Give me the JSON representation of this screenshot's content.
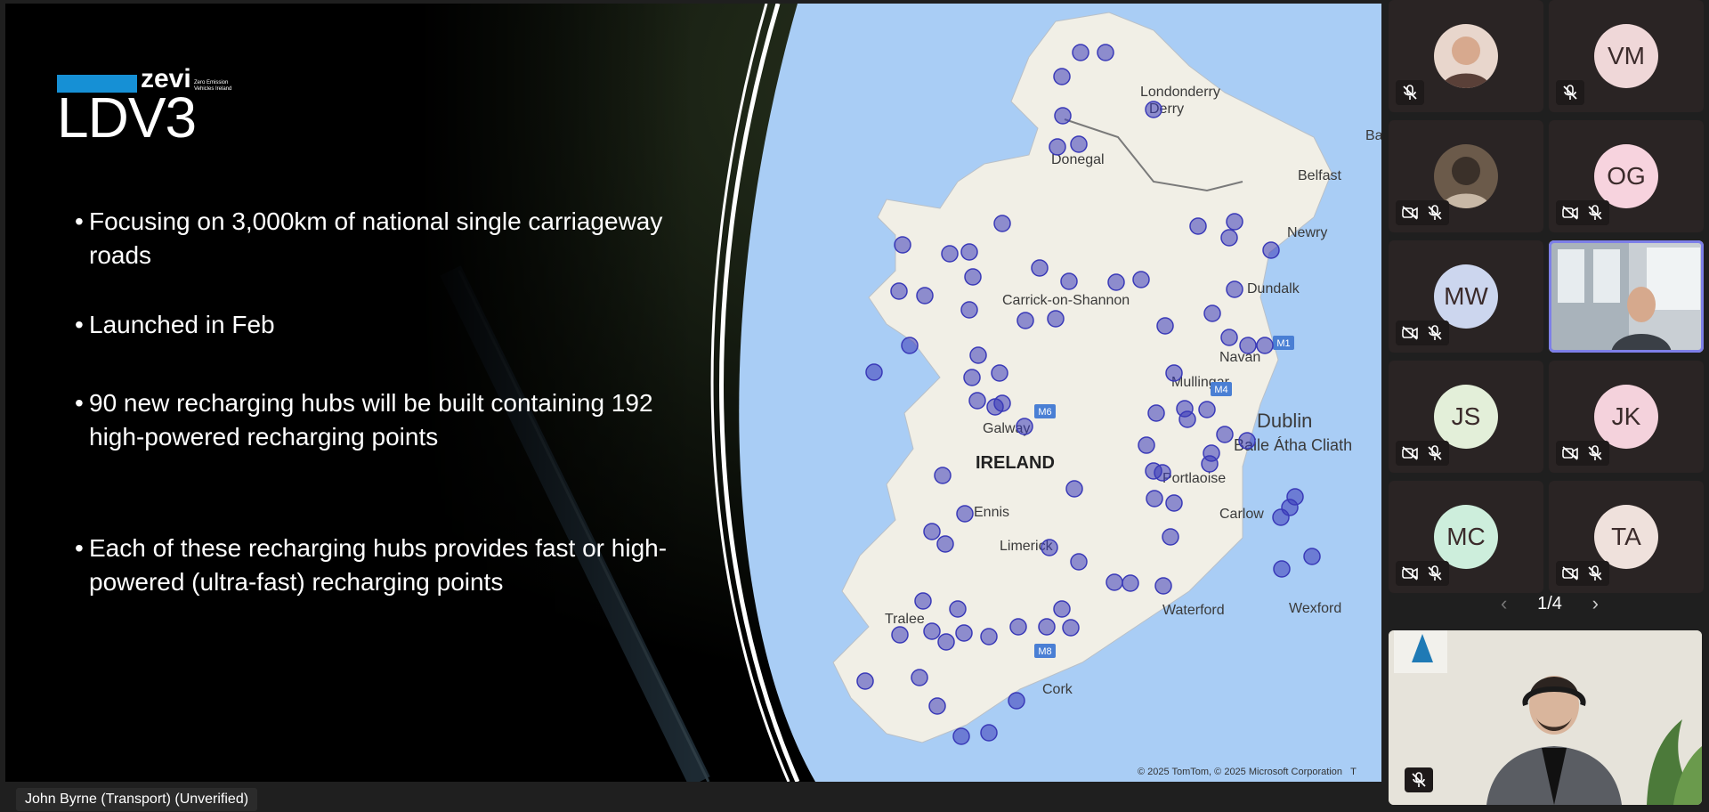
{
  "slide": {
    "logo": {
      "brand": "zevi",
      "brand_sub": "Zero Emission Vehicles Ireland",
      "title": "LDV3"
    },
    "bullets": [
      "Focusing on 3,000km of national single carriageway roads",
      "Launched in Feb",
      "90 new recharging hubs will be built containing 192 high-powered recharging points",
      "Each of these recharging hubs provides fast or high-powered (ultra-fast) recharging points"
    ],
    "bullet_char": "•",
    "map": {
      "country_label": "IRELAND",
      "place_labels": [
        "Londonderry",
        "Derry",
        "Donegal",
        "Belfast",
        "Ban",
        "Newry",
        "Dundalk",
        "Carrick-on-Shannon",
        "Navan",
        "Mullingar",
        "Dublin",
        "Baile Átha Cliath",
        "Galway",
        "Portlaoise",
        "Ennis",
        "Carlow",
        "Limerick",
        "Tralee",
        "Waterford",
        "Wexford",
        "Cork"
      ],
      "road_labels": [
        "M1",
        "M4",
        "M6",
        "M8"
      ],
      "copyright": "© 2025 TomTom, © 2025 Microsoft Corporation",
      "copyright_suffix": "T",
      "hub_color": "#3a3ab8",
      "land_color": "#f1efe6",
      "sea_color": "#a9cdf5"
    }
  },
  "speaker_tag": "John Byrne (Transport) (Unverified)",
  "participants": [
    {
      "initials": "",
      "type": "photo",
      "mic_muted": true,
      "video_off": false
    },
    {
      "initials": "VM",
      "color": "#efd7d8",
      "mic_muted": true,
      "video_off": false
    },
    {
      "initials": "",
      "type": "photo",
      "mic_muted": true,
      "video_off": true
    },
    {
      "initials": "OG",
      "color": "#f7d3de",
      "mic_muted": true,
      "video_off": true
    },
    {
      "initials": "MW",
      "color": "#ccd6ee",
      "mic_muted": true,
      "video_off": true
    },
    {
      "initials": "",
      "type": "video",
      "selected": true,
      "mic_muted": false,
      "video_off": false
    },
    {
      "initials": "JS",
      "color": "#e3efd9",
      "mic_muted": true,
      "video_off": true
    },
    {
      "initials": "JK",
      "color": "#f4d2dc",
      "mic_muted": true,
      "video_off": true
    },
    {
      "initials": "MC",
      "color": "#cdeedc",
      "mic_muted": true,
      "video_off": true
    },
    {
      "initials": "TA",
      "color": "#efe1dc",
      "mic_muted": true,
      "video_off": true
    }
  ],
  "pager": {
    "label": "1/4",
    "prev": "‹",
    "next": "›"
  },
  "colors": {
    "accent": "#7d7fe8",
    "tile_bg": "#2a2424"
  }
}
